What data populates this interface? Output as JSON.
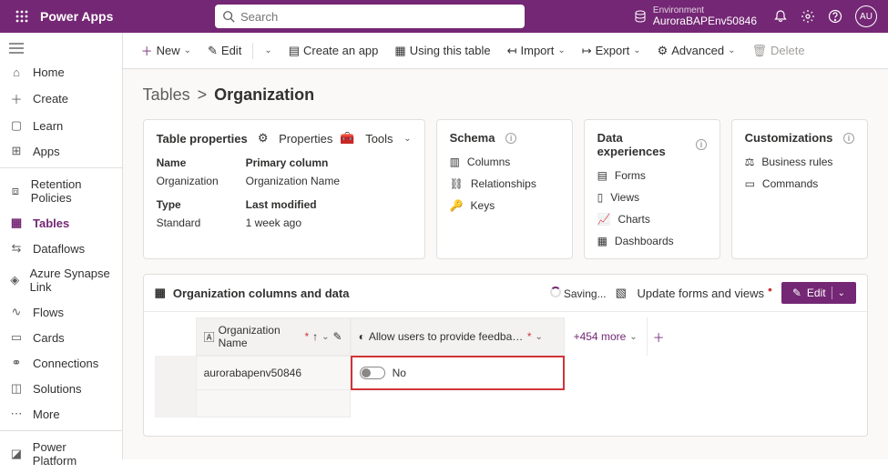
{
  "header": {
    "appTitle": "Power Apps",
    "searchPlaceholder": "Search",
    "envLabel": "Environment",
    "envName": "AuroraBAPEnv50846",
    "avatar": "AU"
  },
  "sidebar": {
    "items": [
      {
        "label": "Home"
      },
      {
        "label": "Create"
      },
      {
        "label": "Learn"
      },
      {
        "label": "Apps"
      },
      {
        "label": "Retention Policies"
      },
      {
        "label": "Tables"
      },
      {
        "label": "Dataflows"
      },
      {
        "label": "Azure Synapse Link"
      },
      {
        "label": "Flows"
      },
      {
        "label": "Cards"
      },
      {
        "label": "Connections"
      },
      {
        "label": "Solutions"
      },
      {
        "label": "More"
      },
      {
        "label": "Power Platform"
      }
    ]
  },
  "cmdbar": {
    "new": "New",
    "edit": "Edit",
    "createApp": "Create an app",
    "usingTable": "Using this table",
    "import": "Import",
    "export": "Export",
    "advanced": "Advanced",
    "delete": "Delete"
  },
  "breadcrumb": {
    "parent": "Tables",
    "sep": ">",
    "current": "Organization"
  },
  "propsCard": {
    "title": "Table properties",
    "propertiesBtn": "Properties",
    "toolsBtn": "Tools",
    "nameLabel": "Name",
    "nameValue": "Organization",
    "typeLabel": "Type",
    "typeValue": "Standard",
    "primaryLabel": "Primary column",
    "primaryValue": "Organization Name",
    "modifiedLabel": "Last modified",
    "modifiedValue": "1 week ago"
  },
  "schemaCard": {
    "title": "Schema",
    "items": [
      "Columns",
      "Relationships",
      "Keys"
    ]
  },
  "expCard": {
    "title": "Data experiences",
    "items": [
      "Forms",
      "Views",
      "Charts",
      "Dashboards"
    ]
  },
  "custCard": {
    "title": "Customizations",
    "items": [
      "Business rules",
      "Commands"
    ]
  },
  "grid": {
    "title": "Organization columns and data",
    "saving": "Saving...",
    "updateForms": "Update forms and views",
    "editBtn": "Edit",
    "col1": "Organization Name",
    "col2": "Allow users to provide feedback for App Copilot",
    "moreCols": "+454 more",
    "row1_name": "aurorabapenv50846",
    "row1_toggle": "No"
  }
}
